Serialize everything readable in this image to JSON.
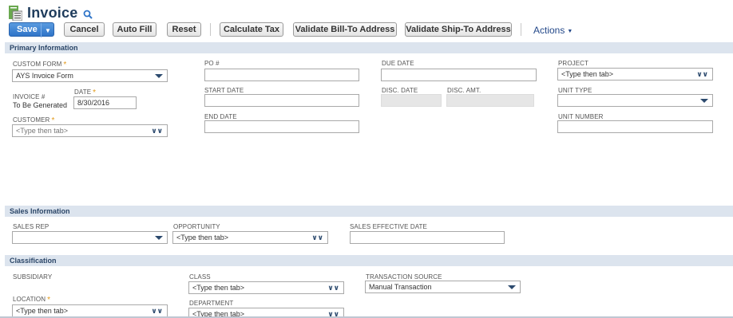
{
  "header": {
    "title": "Invoice",
    "icon": "invoice-icon",
    "search_icon": "search-icon"
  },
  "toolbar": {
    "save_label": "Save",
    "cancel_label": "Cancel",
    "auto_fill_label": "Auto Fill",
    "reset_label": "Reset",
    "calculate_tax_label": "Calculate Tax",
    "validate_bill_to_label": "Validate Bill-To Address",
    "validate_ship_to_label": "Validate Ship-To Address",
    "actions_label": "Actions"
  },
  "sections": {
    "primary": "Primary Information",
    "sales": "Sales Information",
    "classification": "Classification"
  },
  "primary": {
    "custom_form_label": "CUSTOM FORM",
    "custom_form_value": "AYS Invoice Form",
    "invoice_no_label": "INVOICE #",
    "invoice_no_value": "To Be Generated",
    "date_label": "DATE",
    "date_value": "8/30/2016",
    "customer_label": "CUSTOMER",
    "customer_placeholder": "<Type then tab>",
    "po_label": "PO #",
    "start_date_label": "START DATE",
    "end_date_label": "END DATE",
    "due_date_label": "DUE DATE",
    "disc_date_label": "DISC. DATE",
    "disc_amt_label": "DISC. AMT.",
    "project_label": "PROJECT",
    "project_value": "<Type then tab>",
    "unit_type_label": "UNIT TYPE",
    "unit_number_label": "UNIT NUMBER"
  },
  "sales": {
    "sales_rep_label": "SALES REP",
    "opportunity_label": "OPPORTUNITY",
    "opportunity_value": "<Type then tab>",
    "sales_effective_date_label": "SALES EFFECTIVE DATE"
  },
  "classification": {
    "subsidiary_label": "SUBSIDIARY",
    "location_label": "LOCATION",
    "location_value": "<Type then tab>",
    "class_label": "CLASS",
    "class_value": "<Type then tab>",
    "department_label": "DEPARTMENT",
    "department_value": "<Type then tab>",
    "transaction_source_label": "TRANSACTION SOURCE",
    "transaction_source_value": "Manual Transaction"
  },
  "colors": {
    "accent": "#2f74c8",
    "section_bg": "#dce4ee",
    "title": "#1f3c5c",
    "required": "#e29a1a"
  }
}
